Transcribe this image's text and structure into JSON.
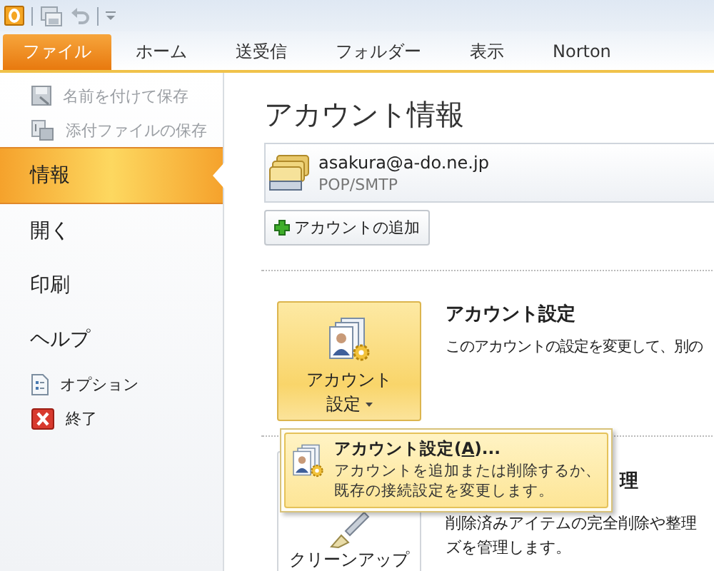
{
  "ribbon_tabs": [
    {
      "label": "ファイル",
      "selected": true
    },
    {
      "label": "ホーム",
      "selected": false
    },
    {
      "label": "送受信",
      "selected": false
    },
    {
      "label": "フォルダー",
      "selected": false
    },
    {
      "label": "表示",
      "selected": false
    },
    {
      "label": "Norton",
      "selected": false
    }
  ],
  "backstage_menu": [
    {
      "label": "名前を付けて保存",
      "kind": "command",
      "disabled": true,
      "selected": false
    },
    {
      "label": "添付ファイルの保存",
      "kind": "command",
      "disabled": true,
      "selected": false
    },
    {
      "label": "情報",
      "kind": "page",
      "disabled": false,
      "selected": true
    },
    {
      "label": "開く",
      "kind": "page",
      "disabled": false,
      "selected": false
    },
    {
      "label": "印刷",
      "kind": "page",
      "disabled": false,
      "selected": false
    },
    {
      "label": "ヘルプ",
      "kind": "page",
      "disabled": false,
      "selected": false
    },
    {
      "label": "オプション",
      "kind": "command",
      "disabled": false,
      "selected": false
    },
    {
      "label": "終了",
      "kind": "command",
      "disabled": false,
      "selected": false
    }
  ],
  "page_title": "アカウント情報",
  "account": {
    "email": "asakura@a-do.ne.jp",
    "type": "POP/SMTP"
  },
  "add_account_button": "アカウントの追加",
  "sections": [
    {
      "button_lines": [
        "アカウント",
        "設定"
      ],
      "has_dropdown": true,
      "heading": "アカウント設定",
      "description": [
        "このアカウントの設定を変更して、別の"
      ]
    },
    {
      "button_lines": [
        "クリーンアップ"
      ],
      "has_dropdown": false,
      "heading": "理",
      "description": [
        "削除済みアイテムの完全削除や整理",
        "ズを管理します。"
      ]
    }
  ],
  "dropdown_menu": {
    "title_before": "アカウント設定(",
    "access_key": "A",
    "title_after": ")...",
    "description": [
      "アカウントを追加または削除するか、",
      "既存の接続設定を変更します。"
    ]
  }
}
